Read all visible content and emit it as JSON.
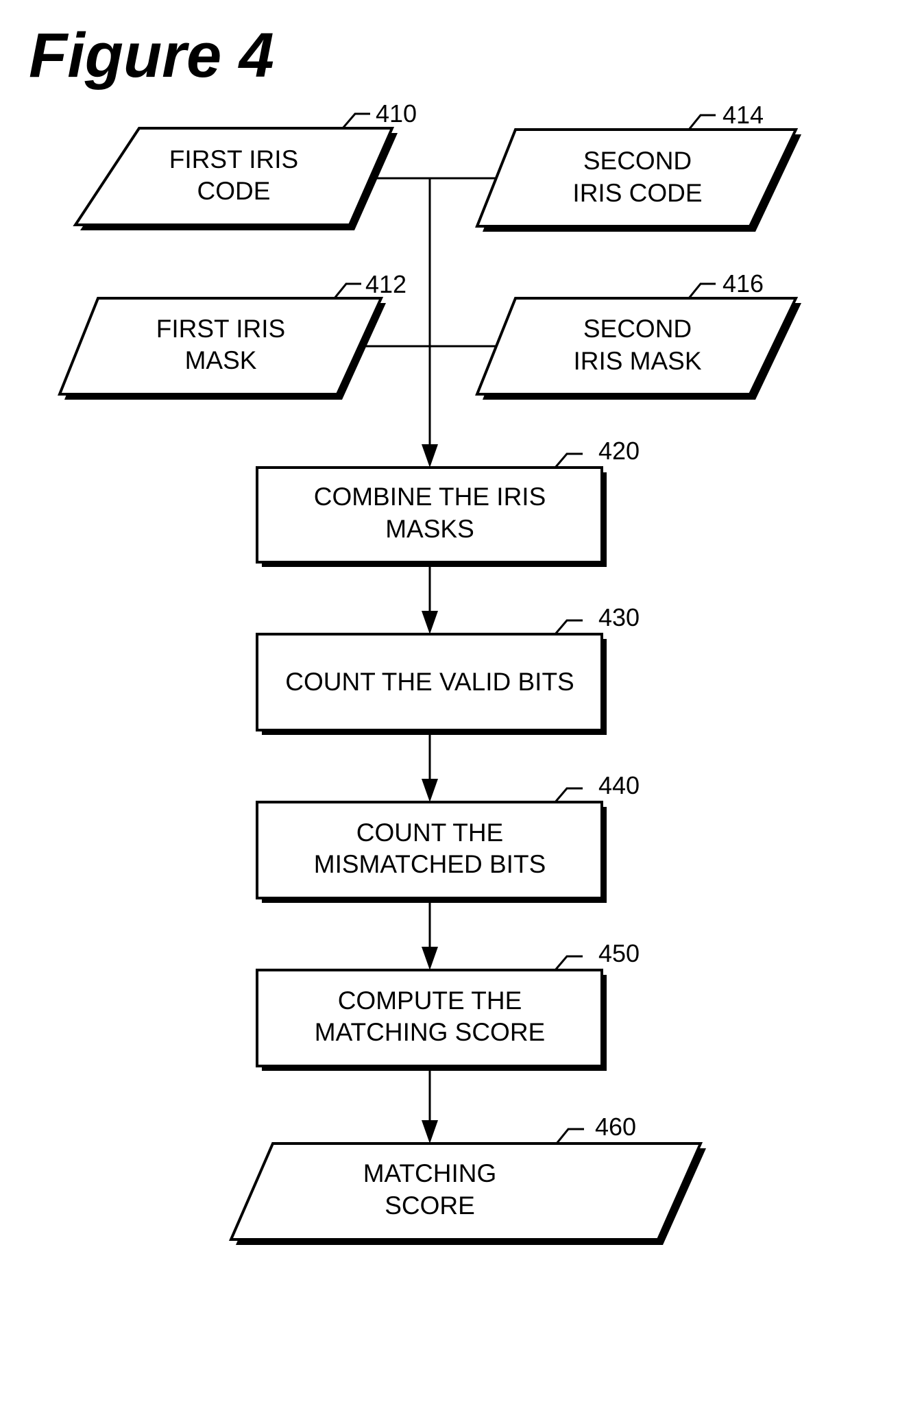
{
  "figure": {
    "title": "Figure 4"
  },
  "nodes": {
    "n410": {
      "ref": "410",
      "line1": "FIRST IRIS",
      "line2": "CODE",
      "shape": "parallelogram"
    },
    "n414": {
      "ref": "414",
      "line1": "SECOND",
      "line2": "IRIS CODE",
      "shape": "parallelogram"
    },
    "n412": {
      "ref": "412",
      "line1": "FIRST IRIS",
      "line2": "MASK",
      "shape": "parallelogram"
    },
    "n416": {
      "ref": "416",
      "line1": "SECOND",
      "line2": "IRIS MASK",
      "shape": "parallelogram"
    },
    "n420": {
      "ref": "420",
      "line1": "COMBINE THE IRIS",
      "line2": "MASKS",
      "shape": "rectangle"
    },
    "n430": {
      "ref": "430",
      "line1": "COUNT THE VALID BITS",
      "shape": "rectangle"
    },
    "n440": {
      "ref": "440",
      "line1": "COUNT THE",
      "line2": "MISMATCHED BITS",
      "shape": "rectangle"
    },
    "n450": {
      "ref": "450",
      "line1": "COMPUTE THE",
      "line2": "MATCHING SCORE",
      "shape": "rectangle"
    },
    "n460": {
      "ref": "460",
      "line1": "MATCHING",
      "line2": "SCORE",
      "shape": "parallelogram"
    }
  },
  "edges": [
    {
      "from": "410",
      "to": "420"
    },
    {
      "from": "414",
      "to": "420"
    },
    {
      "from": "412",
      "to": "420"
    },
    {
      "from": "416",
      "to": "420"
    },
    {
      "from": "420",
      "to": "430"
    },
    {
      "from": "430",
      "to": "440"
    },
    {
      "from": "440",
      "to": "450"
    },
    {
      "from": "450",
      "to": "460"
    }
  ]
}
